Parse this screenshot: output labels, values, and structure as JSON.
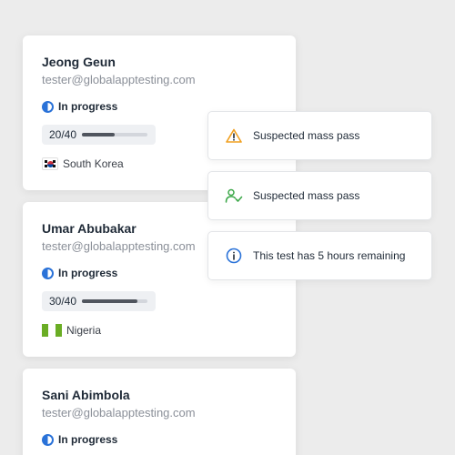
{
  "testers": [
    {
      "name": "Jeong Geun",
      "email": "tester@globalapptesting.com",
      "status": "In progress",
      "progress_label": "20/40",
      "progress_fraction": 0.5,
      "country": "South Korea",
      "flag_icon": "south-korea-flag-icon"
    },
    {
      "name": "Umar Abubakar",
      "email": "tester@globalapptesting.com",
      "status": "In progress",
      "progress_label": "30/40",
      "progress_fraction": 0.85,
      "country": "Nigeria",
      "flag_icon": "nigeria-flag-icon"
    },
    {
      "name": "Sani Abimbola",
      "email": "tester@globalapptesting.com",
      "status": "In progress"
    }
  ],
  "notifications": [
    {
      "text": "Suspected mass pass",
      "icon": "warning-triangle-icon",
      "color": "#f0a020"
    },
    {
      "text": "Suspected mass pass",
      "icon": "user-check-icon",
      "color": "#3da84a"
    },
    {
      "text": "This test has 5 hours remaining",
      "icon": "info-circle-icon",
      "color": "#2a72d8"
    }
  ],
  "colors": {
    "accent_blue": "#2a72d8",
    "background": "#ececec",
    "card": "#ffffff"
  }
}
